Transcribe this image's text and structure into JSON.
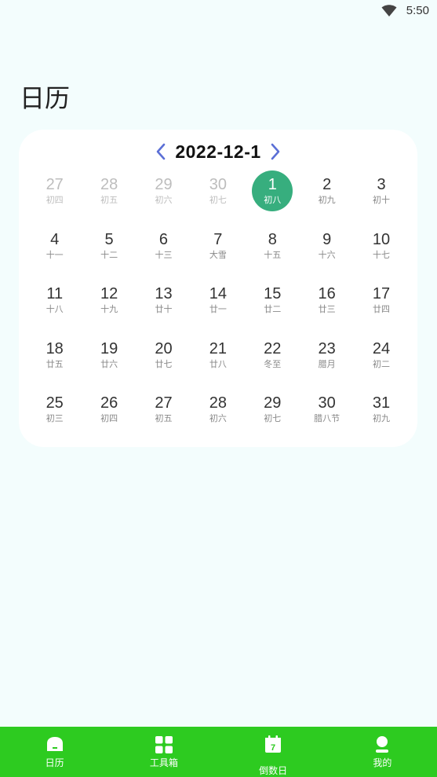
{
  "status": {
    "time": "5:50"
  },
  "page": {
    "title": "日历"
  },
  "calendar": {
    "month_label": "2022-12-1",
    "days": [
      {
        "day": "27",
        "lunar": "初四",
        "state": "other"
      },
      {
        "day": "28",
        "lunar": "初五",
        "state": "other"
      },
      {
        "day": "29",
        "lunar": "初六",
        "state": "other"
      },
      {
        "day": "30",
        "lunar": "初七",
        "state": "other"
      },
      {
        "day": "1",
        "lunar": "初八",
        "state": "selected"
      },
      {
        "day": "2",
        "lunar": "初九",
        "state": "current"
      },
      {
        "day": "3",
        "lunar": "初十",
        "state": "current"
      },
      {
        "day": "4",
        "lunar": "十一",
        "state": "current"
      },
      {
        "day": "5",
        "lunar": "十二",
        "state": "current"
      },
      {
        "day": "6",
        "lunar": "十三",
        "state": "current"
      },
      {
        "day": "7",
        "lunar": "大雪",
        "state": "current"
      },
      {
        "day": "8",
        "lunar": "十五",
        "state": "current"
      },
      {
        "day": "9",
        "lunar": "十六",
        "state": "current"
      },
      {
        "day": "10",
        "lunar": "十七",
        "state": "current"
      },
      {
        "day": "11",
        "lunar": "十八",
        "state": "current"
      },
      {
        "day": "12",
        "lunar": "十九",
        "state": "current"
      },
      {
        "day": "13",
        "lunar": "廿十",
        "state": "current"
      },
      {
        "day": "14",
        "lunar": "廿一",
        "state": "current"
      },
      {
        "day": "15",
        "lunar": "廿二",
        "state": "current"
      },
      {
        "day": "16",
        "lunar": "廿三",
        "state": "current"
      },
      {
        "day": "17",
        "lunar": "廿四",
        "state": "current"
      },
      {
        "day": "18",
        "lunar": "廿五",
        "state": "current"
      },
      {
        "day": "19",
        "lunar": "廿六",
        "state": "current"
      },
      {
        "day": "20",
        "lunar": "廿七",
        "state": "current"
      },
      {
        "day": "21",
        "lunar": "廿八",
        "state": "current"
      },
      {
        "day": "22",
        "lunar": "冬至",
        "state": "current"
      },
      {
        "day": "23",
        "lunar": "腊月",
        "state": "current"
      },
      {
        "day": "24",
        "lunar": "初二",
        "state": "current"
      },
      {
        "day": "25",
        "lunar": "初三",
        "state": "current"
      },
      {
        "day": "26",
        "lunar": "初四",
        "state": "current"
      },
      {
        "day": "27",
        "lunar": "初五",
        "state": "current"
      },
      {
        "day": "28",
        "lunar": "初六",
        "state": "current"
      },
      {
        "day": "29",
        "lunar": "初七",
        "state": "current"
      },
      {
        "day": "30",
        "lunar": "腊八节",
        "state": "current"
      },
      {
        "day": "31",
        "lunar": "初九",
        "state": "current"
      }
    ]
  },
  "nav": {
    "items": [
      {
        "label": "日历",
        "icon": "home-icon"
      },
      {
        "label": "工具箱",
        "icon": "grid-icon"
      },
      {
        "label": "倒数日",
        "icon": "calendar-icon",
        "badge": "7"
      },
      {
        "label": "我的",
        "icon": "person-icon"
      }
    ]
  },
  "colors": {
    "background": "#f3fdfd",
    "card": "#ffffff",
    "selected": "#37ae7e",
    "arrows": "#5b6fd6",
    "nav_bar": "#2dcb20"
  }
}
